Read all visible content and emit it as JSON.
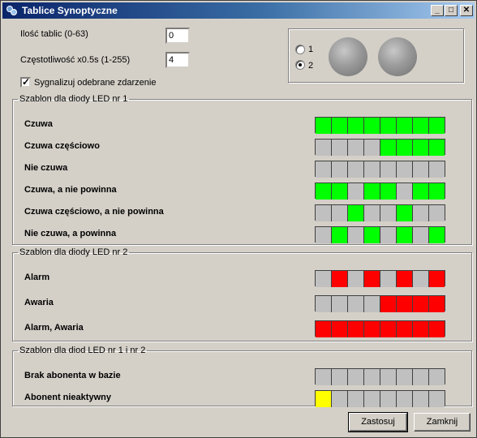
{
  "window": {
    "title": "Tablice Synoptyczne"
  },
  "titlebar_buttons": {
    "minimize": "_",
    "maximize": "□",
    "close": "✕"
  },
  "settings": {
    "boards_label": "Ilość tablic (0-63)",
    "boards_value": "0",
    "freq_label": "Częstotliwość x0.5s (1-255)",
    "freq_value": "4",
    "signal_label": "Sygnalizuj odebrane zdarzenie",
    "signal_checked": true
  },
  "preview": {
    "options": [
      {
        "label": "1",
        "selected": false
      },
      {
        "label": "2",
        "selected": true
      }
    ]
  },
  "colors": {
    "off": "#c0c0c0",
    "green": "#00ff00",
    "red": "#ff0000",
    "yellow": "#ffff00"
  },
  "groups": [
    {
      "legend": "Szablon dla diody LED nr 1",
      "rows": [
        {
          "label": "Czuwa",
          "cells": [
            "green",
            "green",
            "green",
            "green",
            "green",
            "green",
            "green",
            "green"
          ]
        },
        {
          "label": "Czuwa częściowo",
          "cells": [
            "off",
            "off",
            "off",
            "off",
            "green",
            "green",
            "green",
            "green"
          ]
        },
        {
          "label": "Nie czuwa",
          "cells": [
            "off",
            "off",
            "off",
            "off",
            "off",
            "off",
            "off",
            "off"
          ]
        },
        {
          "label": "Czuwa, a nie powinna",
          "cells": [
            "green",
            "green",
            "off",
            "green",
            "green",
            "off",
            "green",
            "green"
          ]
        },
        {
          "label": "Czuwa częściowo, a nie powinna",
          "cells": [
            "off",
            "off",
            "green",
            "off",
            "off",
            "green",
            "off",
            "off"
          ]
        },
        {
          "label": "Nie czuwa, a powinna",
          "cells": [
            "off",
            "green",
            "off",
            "green",
            "off",
            "green",
            "off",
            "green"
          ]
        }
      ]
    },
    {
      "legend": "Szablon dla diody LED nr 2",
      "rows": [
        {
          "label": "Alarm",
          "cells": [
            "off",
            "red",
            "off",
            "red",
            "off",
            "red",
            "off",
            "red"
          ]
        },
        {
          "label": "Awaria",
          "cells": [
            "off",
            "off",
            "off",
            "off",
            "red",
            "red",
            "red",
            "red"
          ]
        },
        {
          "label": "Alarm, Awaria",
          "cells": [
            "red",
            "red",
            "red",
            "red",
            "red",
            "red",
            "red",
            "red"
          ]
        }
      ]
    },
    {
      "legend": "Szablon dla diod LED nr 1 i nr 2",
      "rows": [
        {
          "label": "Brak abonenta w bazie",
          "cells": [
            "off",
            "off",
            "off",
            "off",
            "off",
            "off",
            "off",
            "off"
          ]
        },
        {
          "label": "Abonent nieaktywny",
          "cells": [
            "yellow",
            "off",
            "off",
            "off",
            "off",
            "off",
            "off",
            "off"
          ]
        }
      ]
    }
  ],
  "buttons": {
    "apply": "Zastosuj",
    "close": "Zamknij"
  }
}
